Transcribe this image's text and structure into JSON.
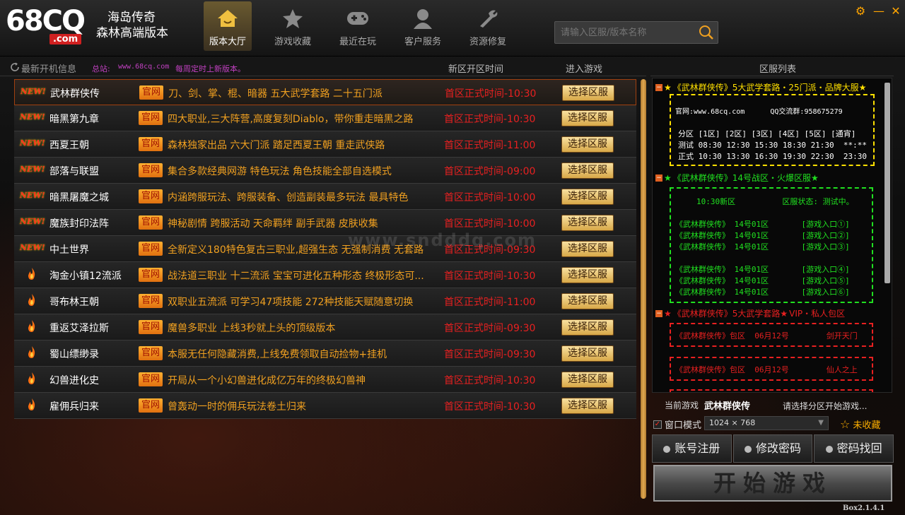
{
  "header": {
    "logo_text": "68CQ",
    "logo_com": ".com",
    "subtitle_line1": "海岛传奇",
    "subtitle_line2": "森林高端版本",
    "nav": [
      {
        "label": "版本大厅",
        "icon": "home-icon",
        "active": true
      },
      {
        "label": "游戏收藏",
        "icon": "star-icon",
        "active": false
      },
      {
        "label": "最近在玩",
        "icon": "gamepad-icon",
        "active": false
      },
      {
        "label": "客户服务",
        "icon": "user-icon",
        "active": false
      },
      {
        "label": "资源修复",
        "icon": "wrench-icon",
        "active": false
      }
    ],
    "search_placeholder": "请输入区服/版本名称",
    "window_controls": {
      "settings": "⚙",
      "minimize": "—",
      "close": "✕"
    }
  },
  "left": {
    "title": "最新开机信息",
    "site_label": "总站:",
    "site_url": "www.68cq.com",
    "update_text": "每周定时上新版本。",
    "col_time": "新区开区时间",
    "col_enter": "进入游戏",
    "watermark": "www.sndddq.com",
    "tag_label": "官网",
    "button_label": "选择区服",
    "rows": [
      {
        "badge": "NEW!",
        "name": "武林群侠传",
        "desc": "刀、剑、掌、棍、暗器 五大武学套路 二十五门派",
        "time": "首区正式时间-10:30"
      },
      {
        "badge": "NEW!",
        "name": "暗黑第九章",
        "desc": "四大职业,三大阵营,高度复刻Diablo，带你重走暗黑之路",
        "time": "首区正式时间-10:30"
      },
      {
        "badge": "NEW!",
        "name": "西夏王朝",
        "desc": "森林独家出品 六大门派 踏足西夏王朝 重走武侠路",
        "time": "首区正式时间-11:00"
      },
      {
        "badge": "NEW!",
        "name": "部落与联盟",
        "desc": "集合多款经典网游 特色玩法 角色技能全部自选模式",
        "time": "首区正式时间-09:00"
      },
      {
        "badge": "NEW!",
        "name": "暗黑屠魔之城",
        "desc": "内涵跨服玩法、跨服装备、创造副装最多玩法 最具特色",
        "time": "首区正式时间-10:00"
      },
      {
        "badge": "NEW!",
        "name": "魔族封印法阵",
        "desc": "神秘剧情 跨服活动 天命羁绊 副手武器 皮肤收集",
        "time": "首区正式时间-10:00"
      },
      {
        "badge": "NEW!",
        "name": "中土世界",
        "desc": "全新定义180特色复古三职业,超强生态 无强制消费 无套路",
        "time": "首区正式时间-09:30"
      },
      {
        "badge": "fire",
        "name": "淘金小镇12流派",
        "desc": "战法道三职业 十二流派 宝宝可进化五种形态 终极形态可...",
        "time": "首区正式时间-10:30"
      },
      {
        "badge": "fire",
        "name": "哥布林王朝",
        "desc": "双职业五流派 可学习47项技能 272种技能天赋随意切换",
        "time": "首区正式时间-11:00"
      },
      {
        "badge": "fire",
        "name": "重返艾泽拉斯",
        "desc": "魔兽多职业 上线3秒就上头的顶级版本",
        "time": "首区正式时间-09:30"
      },
      {
        "badge": "fire",
        "name": "蜀山缥缈录",
        "desc": "本服无任何隐藏消费,上线免费领取自动捡物+挂机",
        "time": "首区正式时间-09:30"
      },
      {
        "badge": "fire",
        "name": "幻兽进化史",
        "desc": "开局从一个小幻兽进化成亿万年的终极幻兽神",
        "time": "首区正式时间-10:30"
      },
      {
        "badge": "fire",
        "name": "雇佣兵归来",
        "desc": "曾轰动一时的佣兵玩法卷土归来",
        "time": "首区正式时间-10:30"
      }
    ]
  },
  "right": {
    "title": "区服列表",
    "group1": {
      "head": "《武林群侠传》5大武学套路・25门派・品牌大服",
      "line1": "官网:www.68cq.com      QQ交流群:958675279",
      "line2": "分区 [1区] [2区] [3区] [4区] [5区] [通宵]",
      "line3": "测试 08:30 12:30 15:30 18:30 21:30  **:**",
      "line4": "正式 10:30 13:30 16:30 19:30 22:30  23:30"
    },
    "group2": {
      "head": "《武林群侠传》14号战区・火爆区服",
      "line1": "10:30新区          区服状态: 测试中。",
      "rows": [
        "《武林群侠传》 14号01区       [游戏入口①]",
        "《武林群侠传》 14号01区       [游戏入口②]",
        "《武林群侠传》 14号01区       [游戏入口③]",
        "《武林群侠传》 14号01区       [游戏入口④]",
        "《武林群侠传》 14号01区       [游戏入口⑤]",
        "《武林群侠传》 14号01区       [游戏入口⑥]"
      ]
    },
    "group3": {
      "head": "《武林群侠传》5大武学套路",
      "head_suffix": "VIP・私人包区",
      "row1": "《武林群侠传》包区  06月12号        剑开天门",
      "row2": "《武林群侠传》包区  06月12号        仙人之上"
    },
    "current_label": "当前游戏",
    "current_name": "武林群侠传",
    "current_hint": "请选择分区开始游戏...",
    "window_mode_label": "窗口模式",
    "resolution": "1024  ×  768",
    "favorite_label": "未收藏",
    "btn_register": "账号注册",
    "btn_change_pw": "修改密码",
    "btn_recover_pw": "密码找回",
    "start_label": "开始游戏",
    "version": "Box2.1.4.1"
  },
  "colors": {
    "accent_orange": "#f0a020",
    "time_red": "#e82020",
    "group_yellow": "#ffe000",
    "group_green": "#20e020",
    "group_red": "#e82020"
  }
}
